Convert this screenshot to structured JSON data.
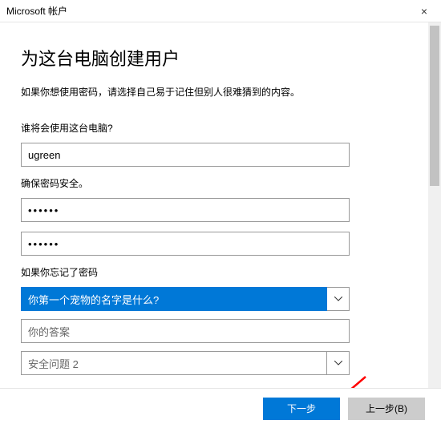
{
  "titlebar": {
    "title": "Microsoft 帐户",
    "close": "×"
  },
  "heading": "为这台电脑创建用户",
  "subtext": "如果你想使用密码，请选择自己易于记住但别人很难猜到的内容。",
  "section_user": {
    "label": "谁将会使用这台电脑?",
    "value": "ugreen"
  },
  "section_pw": {
    "label": "确保密码安全。",
    "pw1": "••••••",
    "pw2": "••••••"
  },
  "section_sec": {
    "label": "如果你忘记了密码",
    "q1_selected": "你第一个宠物的名字是什么?",
    "answer_placeholder": "你的答案",
    "q2_placeholder": "安全问题 2"
  },
  "buttons": {
    "next": "下一步",
    "back": "上一步(B)"
  }
}
